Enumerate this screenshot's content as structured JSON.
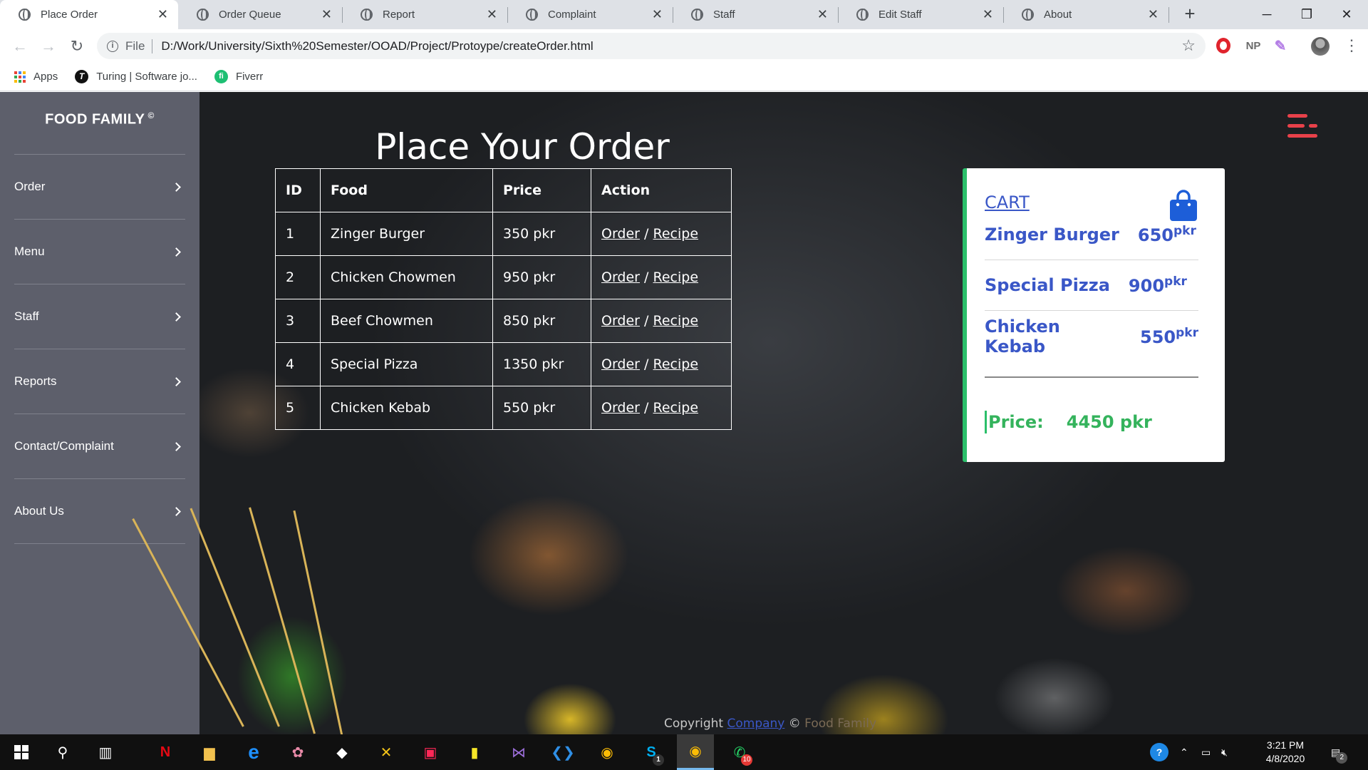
{
  "browser": {
    "tabs": [
      {
        "title": "Place Order",
        "active": true
      },
      {
        "title": "Order Queue",
        "active": false
      },
      {
        "title": "Report",
        "active": false
      },
      {
        "title": "Complaint",
        "active": false
      },
      {
        "title": "Staff",
        "active": false
      },
      {
        "title": "Edit Staff",
        "active": false
      },
      {
        "title": "About",
        "active": false
      }
    ],
    "address": {
      "scheme": "File",
      "url": "D:/Work/University/Sixth%20Semester/OOAD/Project/Protoype/createOrder.html"
    },
    "extensions": {
      "np_label": "NP"
    },
    "bookmarks": [
      {
        "label": "Apps",
        "icon": "apps-grid-icon"
      },
      {
        "label": "Turing | Software jo...",
        "icon": "turing-icon"
      },
      {
        "label": "Fiverr",
        "icon": "fiverr-icon"
      }
    ]
  },
  "sidebar": {
    "brand": "FOOD FAMILY",
    "brand_mark": "©",
    "items": [
      {
        "label": "Order"
      },
      {
        "label": "Menu"
      },
      {
        "label": "Staff"
      },
      {
        "label": "Reports"
      },
      {
        "label": "Contact/Complaint"
      },
      {
        "label": "About Us"
      }
    ]
  },
  "main": {
    "title": "Place Your Order",
    "table": {
      "headers": [
        "ID",
        "Food",
        "Price",
        "Action"
      ],
      "rows": [
        {
          "id": "1",
          "food": "Zinger Burger",
          "price": "350 pkr",
          "order": "Order",
          "sep": "/",
          "recipe": "Recipe"
        },
        {
          "id": "2",
          "food": "Chicken Chowmen",
          "price": "950 pkr",
          "order": "Order",
          "sep": "/",
          "recipe": "Recipe"
        },
        {
          "id": "3",
          "food": "Beef Chowmen",
          "price": "850 pkr",
          "order": "Order",
          "sep": "/",
          "recipe": "Recipe"
        },
        {
          "id": "4",
          "food": "Special Pizza",
          "price": "1350 pkr",
          "order": "Order",
          "sep": "/",
          "recipe": "Recipe"
        },
        {
          "id": "5",
          "food": "Chicken Kebab",
          "price": "550 pkr",
          "order": "Order",
          "sep": "/",
          "recipe": "Recipe"
        }
      ]
    },
    "cart": {
      "title": "CART",
      "items": [
        {
          "name": "Zinger Burger",
          "amount": "650",
          "unit": "pkr"
        },
        {
          "name": "Special Pizza",
          "amount": "900",
          "unit": "pkr"
        },
        {
          "name": "Chicken Kebab",
          "amount": "550",
          "unit": "pkr"
        }
      ],
      "total_label": "Price:",
      "total_value": "4450 pkr"
    },
    "footer": {
      "prefix": "Copyright",
      "company": "Company",
      "mark": "©",
      "brand": "Food Family"
    }
  },
  "taskbar": {
    "badges": {
      "skype": "1",
      "whatsapp": "10",
      "notifications": "2"
    },
    "time": "3:21 PM",
    "date": "4/8/2020"
  },
  "colors": {
    "sidebar_bg": "#5d5f6b",
    "accent_blue": "#3a57c7",
    "accent_green": "#2bbf6a",
    "hamburger_red": "#e8414a"
  }
}
